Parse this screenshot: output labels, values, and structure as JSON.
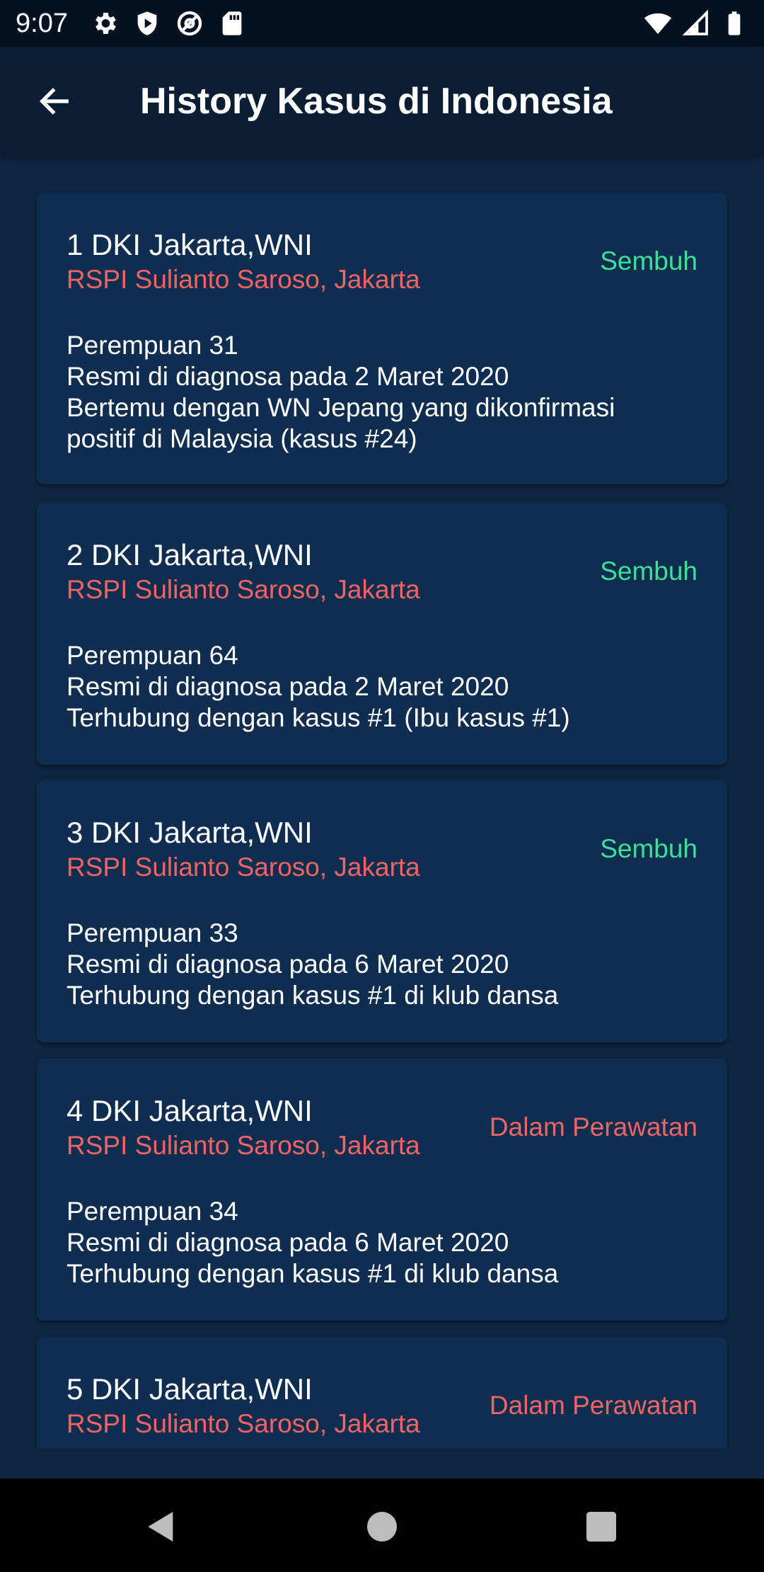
{
  "status_bar": {
    "time": "9:07",
    "left_icons": [
      "gear-icon",
      "shield-icon",
      "at-sign-icon",
      "sd-card-icon"
    ],
    "right_icons": [
      "wifi-icon",
      "cellular-signal-icon",
      "battery-icon"
    ]
  },
  "app_bar": {
    "back_icon": "arrow-left-icon",
    "title": "History Kasus di Indonesia"
  },
  "cases": [
    {
      "title": "1 DKI Jakarta,WNI",
      "hospital": "RSPI Sulianto Saroso, Jakarta",
      "status": "Sembuh",
      "status_color": "#3de09a",
      "details": [
        "Perempuan 31",
        "Resmi di diagnosa pada 2 Maret 2020",
        "Bertemu dengan WN Jepang yang dikonfirmasi",
        "positif di Malaysia (kasus #24)"
      ]
    },
    {
      "title": "2 DKI Jakarta,WNI",
      "hospital": "RSPI Sulianto Saroso, Jakarta",
      "status": "Sembuh",
      "status_color": "#3de09a",
      "details": [
        "Perempuan 64",
        "Resmi di diagnosa pada 2 Maret 2020",
        "Terhubung dengan kasus #1 (Ibu kasus #1)"
      ]
    },
    {
      "title": "3 DKI Jakarta,WNI",
      "hospital": "RSPI Sulianto Saroso, Jakarta",
      "status": "Sembuh",
      "status_color": "#3de09a",
      "details": [
        "Perempuan 33",
        "Resmi di diagnosa pada 6 Maret 2020",
        "Terhubung dengan kasus #1 di klub dansa"
      ]
    },
    {
      "title": "4 DKI Jakarta,WNI",
      "hospital": "RSPI Sulianto Saroso, Jakarta",
      "status": "Dalam Perawatan",
      "status_color": "#ef6464",
      "details": [
        "Perempuan 34",
        "Resmi di diagnosa pada 6 Maret 2020",
        "Terhubung dengan kasus #1 di klub dansa"
      ]
    },
    {
      "title": "5 DKI Jakarta,WNI",
      "hospital": "RSPI Sulianto Saroso, Jakarta",
      "status": "Dalam Perawatan",
      "status_color": "#ef6464",
      "details": []
    }
  ],
  "nav_bar": {
    "back": "nav-back-icon",
    "home": "nav-home-icon",
    "recents": "nav-recents-icon"
  },
  "colors": {
    "background": "#102640",
    "card": "#0f2d4f",
    "app_bar": "#0a1d33",
    "recovered": "#3de09a",
    "treatment": "#ef6464"
  }
}
